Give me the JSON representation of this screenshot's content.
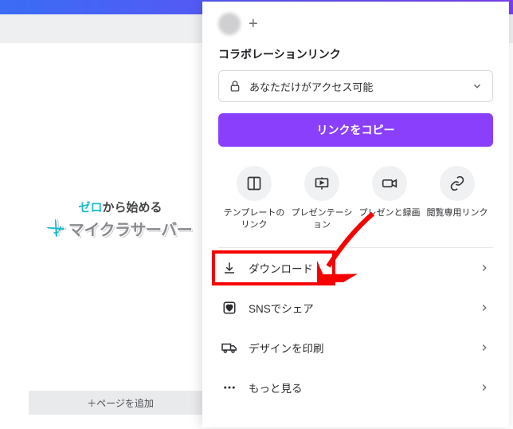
{
  "canvas": {
    "logo_top_accent": "ゼロ",
    "logo_top_rest": "から始める",
    "logo_main": "マイクラサーバー"
  },
  "add_page_label": "＋ページを追加",
  "share": {
    "section_label": "コラボレーションリンク",
    "access_text": "あなただけがアクセス可能",
    "copy_button": "リンクをコピー"
  },
  "icon_buttons": [
    {
      "label": "テンプレートのリンク"
    },
    {
      "label": "プレゼンテーション"
    },
    {
      "label": "プレゼンと録画"
    },
    {
      "label": "閲覧専用リンク"
    }
  ],
  "menu": [
    {
      "label": "ダウンロード"
    },
    {
      "label": "SNSでシェア"
    },
    {
      "label": "デザインを印刷"
    },
    {
      "label": "もっと見る"
    }
  ]
}
